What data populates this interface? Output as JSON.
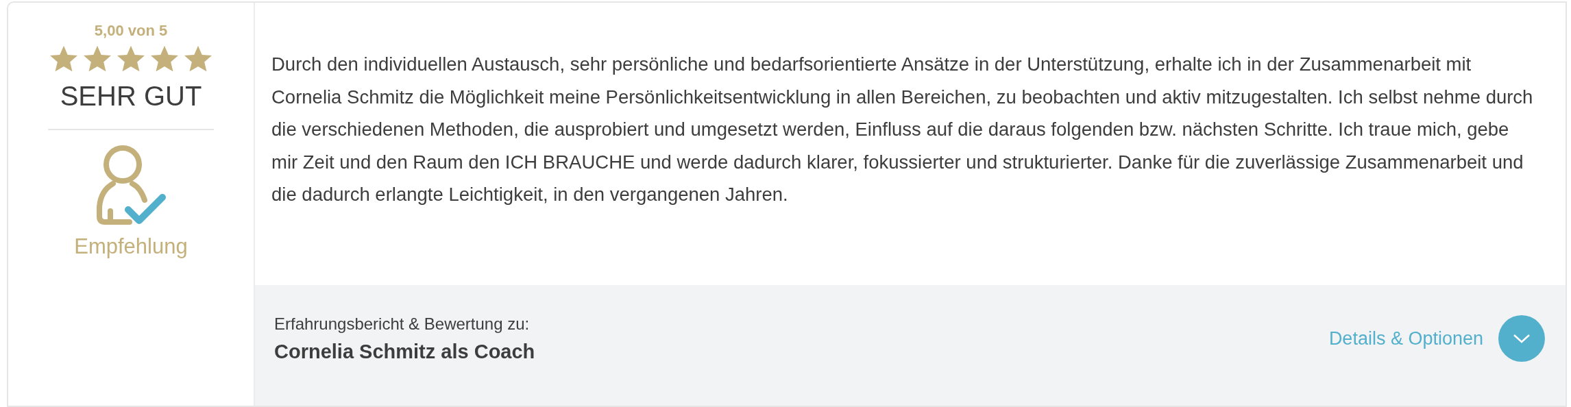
{
  "rating": {
    "score_text": "5,00 von 5",
    "stars": 5,
    "verdict": "SEHR GUT"
  },
  "recommendation": {
    "label": "Empfehlung"
  },
  "review": {
    "text": "Durch den individuellen Austausch, sehr persönliche und bedarfsorientierte Ansätze in der Unterstützung, erhalte ich in der Zusammenarbeit mit Cornelia Schmitz die Möglichkeit meine Persönlichkeitsentwicklung in allen Bereichen, zu beobachten und aktiv mitzugestalten. Ich selbst nehme durch die verschiedenen Methoden, die ausprobiert und umgesetzt werden, Einfluss auf die daraus folgenden bzw. nächsten Schritte. Ich traue mich, gebe mir Zeit und den Raum den ICH BRAUCHE und werde dadurch klarer, fokussierter und strukturierter. Danke für die zuverlässige Zusammenarbeit und die dadurch erlangte Leichtigkeit, in den vergangenen Jahren."
  },
  "footer": {
    "subject_label": "Erfahrungsbericht & Bewertung zu:",
    "subject_name": "Cornelia Schmitz als Coach",
    "details_link": "Details & Optionen"
  }
}
